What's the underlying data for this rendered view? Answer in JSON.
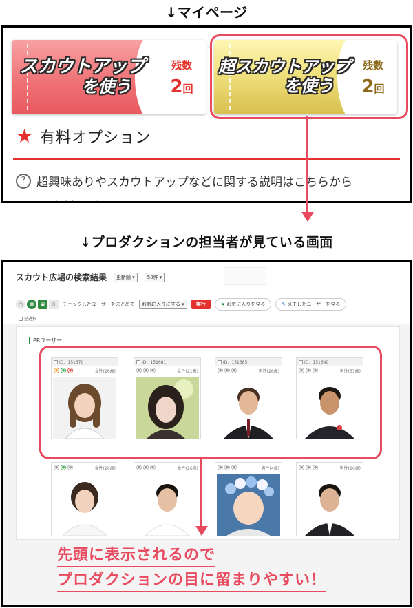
{
  "headings": {
    "mypage": "↓マイページ",
    "production": "↓プロダクションの担当者が見ている画面"
  },
  "mypage": {
    "tickets": [
      {
        "line1": "スカウトアップ",
        "line2": "を使う",
        "remain_label": "残数",
        "remain_count": "2",
        "remain_unit": "回"
      },
      {
        "line1": "超スカウトアップ",
        "line2": "を使う",
        "remain_label": "残数",
        "remain_count": "2",
        "remain_unit": "回"
      }
    ],
    "option_title": "有料オプション",
    "help_icon": "question-circle-icon",
    "help_text": "超興味ありやスカウトアップなどに関する説明はこちらから",
    "cut_text": "有料オプションについて"
  },
  "search": {
    "title": "スカウト広場の検索結果",
    "sort": "更新順",
    "per_page": "50件",
    "bulk_label": "チェックしたユーザーをまとめて",
    "bulk_action": "お気に入りにする",
    "exec": "実行",
    "fav_button": "お気に入りを見る",
    "memo_button": "メモしたユーザーを見る",
    "select_all": "全選択",
    "pr_label": "PRユーザー",
    "pr_cards": [
      {
        "id": "ID：151670",
        "age": "女性(26歳)"
      },
      {
        "id": "ID：151681",
        "age": "女性(21歳)"
      },
      {
        "id": "ID：151685",
        "age": "男性(26歳)"
      },
      {
        "id": "ID：151640",
        "age": "男性(37歳)"
      }
    ],
    "cards": [
      {
        "age": "女性(26歳)"
      },
      {
        "age": "女性(26歳)"
      },
      {
        "age": "男性(4歳)"
      },
      {
        "age": "男性(26歳)"
      }
    ]
  },
  "captions": {
    "line1": "先頭に表示されるので",
    "line2": "プロダクションの目に留まりやすい！"
  },
  "colors": {
    "accent": "#e84a5f",
    "brand_red": "#e5312d",
    "brand_green": "#2d8a3e"
  }
}
